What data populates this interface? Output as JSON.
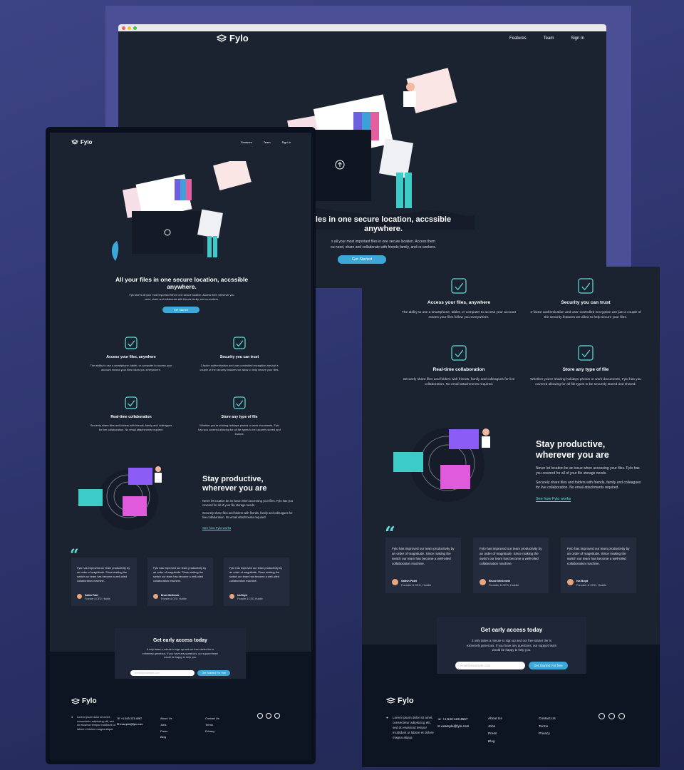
{
  "brand": {
    "name": "Fylo"
  },
  "nav": {
    "features": "Features",
    "team": "Team",
    "signin": "Sign In"
  },
  "hero": {
    "title": "All your files in one secure location, accssible anywhere.",
    "title_partial_line1": "les in one secure location, accssible",
    "title_partial_line2": "anywhere.",
    "subtitle": "Fylo stores all your most important files in one secure location. Access them wherever you need, share and collaborate with friends family, and co-workers.",
    "subtitle_partial_line1": "s all your most important files in one secure location. Access them",
    "subtitle_partial_line2": "ou need, share and collaborate with friends family, and co-workers.",
    "cta": "Get Started"
  },
  "features": [
    {
      "icon": "devices-icon",
      "title": "Access your files, anywhere",
      "text": "The ability to use a smartphone, tablet, or computer to access your account means your files follow you everywhere."
    },
    {
      "icon": "shield-check-icon",
      "title": "Security you can trust",
      "text": "2-factor authentication and user-controlled encryption are just a couple of the security features we allow to help secure your files."
    },
    {
      "icon": "collaboration-icon",
      "title": "Real-time collaboration",
      "text": "Securely share files and folders with friends, family and colleagues for live collaboration. No email attachments required."
    },
    {
      "icon": "folder-files-icon",
      "title": "Store any type of file",
      "text": "Whether you're sharing holidays photos or work documents, Fylo has you covered allowing for all file types to be securely stored and shared."
    }
  ],
  "productive": {
    "title_line1": "Stay productive,",
    "title_line2": "wherever you are",
    "p1": "Never let location be an issue when accessing your files. Fylo has you covered for all of your file storage needs.",
    "p2": "Securely share files and folders with friends, family and colleagues for live collaboration. No email attachments required.",
    "link": "See how Fylo works"
  },
  "testimonials": [
    {
      "text": "Fylo has improved our team productivity by an order of magnitude. Since making the switch our team has become a well-oiled collaboration machine.",
      "name": "Satish Patel",
      "role": "Founder & CEO, Huddle"
    },
    {
      "text": "Fylo has improved our team productivity by an order of magnitude. Since making the switch our team has become a well-oiled collaboration machine.",
      "name": "Bruce McKenzie",
      "role": "Founder & CEO, Huddle"
    },
    {
      "text": "Fylo has improved our team productivity by an order of magnitude. Since making the switch our team has become a well-oiled collaboration machine.",
      "name": "Iva Boyd",
      "role": "Founder & CEO, Huddle"
    }
  ],
  "access": {
    "title": "Get early access today",
    "text": "It only takes a minute to sign up and our free starter tier is extremely generous. If you have any questions, our support team would be happy to help you.",
    "placeholder": "email@example.com",
    "button": "Get Started For free"
  },
  "footer": {
    "address": "Lorem ipsum dolor sit amet, consectetur adipiscing elit, sed do eiusmod tempor incididunt ut labore et dolore magna aliqua",
    "phone": "+1-543-123-4567",
    "email": "example@fylo.com",
    "links1": [
      "About Us",
      "Jobs",
      "Press",
      "Blog"
    ],
    "links2": [
      "Contact Us",
      "Terms",
      "Privacy"
    ],
    "social": [
      "facebook-icon",
      "twitter-icon",
      "instagram-icon"
    ]
  },
  "colors": {
    "bg_dark": "#1b2230",
    "footer": "#0d1422",
    "accent": "#3ba8d9",
    "cyan": "#62e0d9",
    "card": "#232b3d"
  }
}
